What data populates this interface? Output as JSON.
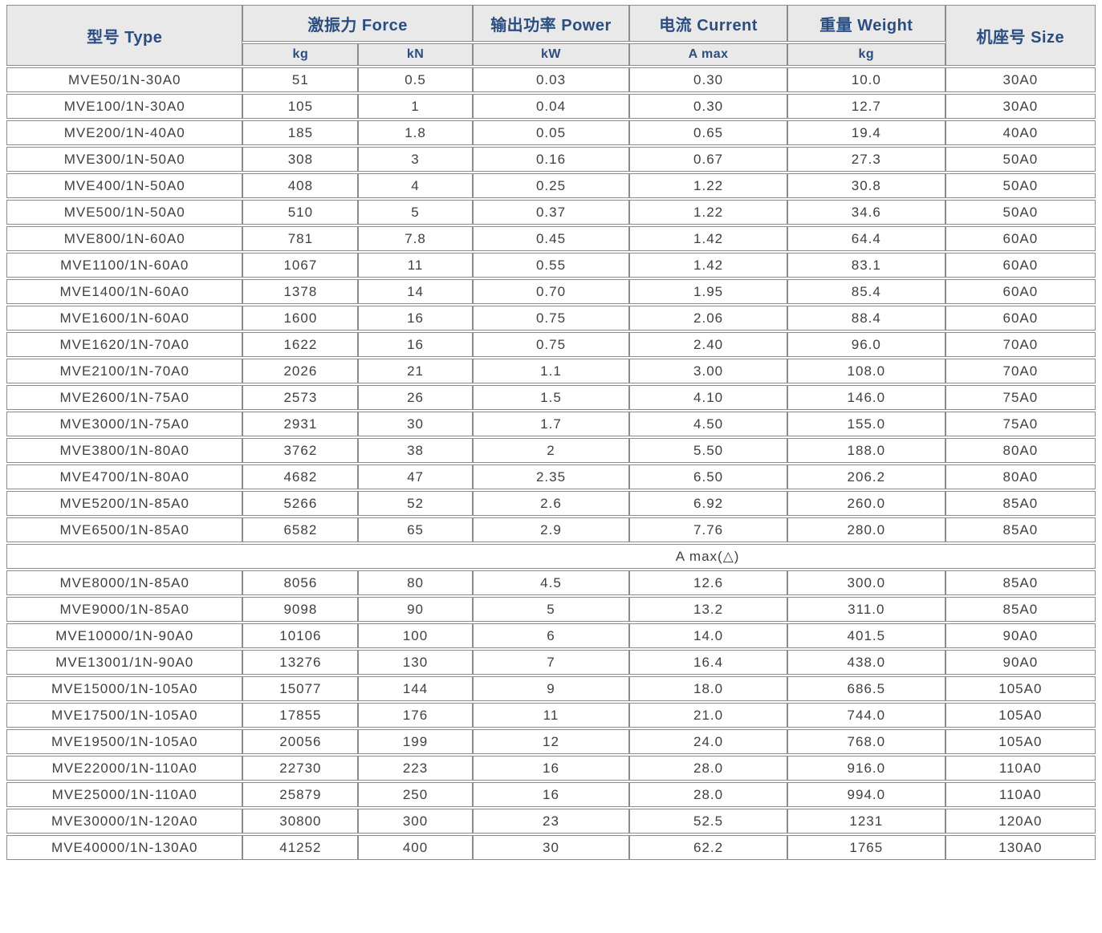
{
  "colors": {
    "header_bg": "#e9e9e9",
    "header_text": "#2b4d80",
    "body_text": "#3f3f3f",
    "border": "#8c8c8c"
  },
  "table": {
    "header": {
      "type": "型号 Type",
      "force": "激振力 Force",
      "power": "输出功率 Power",
      "current": "电流 Current",
      "weight": "重量 Weight",
      "size": "机座号 Size",
      "unit_force_kg": "kg",
      "unit_force_kn": "kN",
      "unit_power_kw": "kW",
      "unit_current_amax": "A max",
      "unit_weight_kg": "kg"
    },
    "separator_label": "A max(△)",
    "rows": [
      [
        "MVE50/1N-30A0",
        "51",
        "0.5",
        "0.03",
        "0.30",
        "10.0",
        "30A0"
      ],
      [
        "MVE100/1N-30A0",
        "105",
        "1",
        "0.04",
        "0.30",
        "12.7",
        "30A0"
      ],
      [
        "MVE200/1N-40A0",
        "185",
        "1.8",
        "0.05",
        "0.65",
        "19.4",
        "40A0"
      ],
      [
        "MVE300/1N-50A0",
        "308",
        "3",
        "0.16",
        "0.67",
        "27.3",
        "50A0"
      ],
      [
        "MVE400/1N-50A0",
        "408",
        "4",
        "0.25",
        "1.22",
        "30.8",
        "50A0"
      ],
      [
        "MVE500/1N-50A0",
        "510",
        "5",
        "0.37",
        "1.22",
        "34.6",
        "50A0"
      ],
      [
        "MVE800/1N-60A0",
        "781",
        "7.8",
        "0.45",
        "1.42",
        "64.4",
        "60A0"
      ],
      [
        "MVE1100/1N-60A0",
        "1067",
        "11",
        "0.55",
        "1.42",
        "83.1",
        "60A0"
      ],
      [
        "MVE1400/1N-60A0",
        "1378",
        "14",
        "0.70",
        "1.95",
        "85.4",
        "60A0"
      ],
      [
        "MVE1600/1N-60A0",
        "1600",
        "16",
        "0.75",
        "2.06",
        "88.4",
        "60A0"
      ],
      [
        "MVE1620/1N-70A0",
        "1622",
        "16",
        "0.75",
        "2.40",
        "96.0",
        "70A0"
      ],
      [
        "MVE2100/1N-70A0",
        "2026",
        "21",
        "1.1",
        "3.00",
        "108.0",
        "70A0"
      ],
      [
        "MVE2600/1N-75A0",
        "2573",
        "26",
        "1.5",
        "4.10",
        "146.0",
        "75A0"
      ],
      [
        "MVE3000/1N-75A0",
        "2931",
        "30",
        "1.7",
        "4.50",
        "155.0",
        "75A0"
      ],
      [
        "MVE3800/1N-80A0",
        "3762",
        "38",
        "2",
        "5.50",
        "188.0",
        "80A0"
      ],
      [
        "MVE4700/1N-80A0",
        "4682",
        "47",
        "2.35",
        "6.50",
        "206.2",
        "80A0"
      ],
      [
        "MVE5200/1N-85A0",
        "5266",
        "52",
        "2.6",
        "6.92",
        "260.0",
        "85A0"
      ],
      [
        "MVE6500/1N-85A0",
        "6582",
        "65",
        "2.9",
        "7.76",
        "280.0",
        "85A0"
      ]
    ],
    "rows_delta": [
      [
        "MVE8000/1N-85A0",
        "8056",
        "80",
        "4.5",
        "12.6",
        "300.0",
        "85A0"
      ],
      [
        "MVE9000/1N-85A0",
        "9098",
        "90",
        "5",
        "13.2",
        "311.0",
        "85A0"
      ],
      [
        "MVE10000/1N-90A0",
        "10106",
        "100",
        "6",
        "14.0",
        "401.5",
        "90A0"
      ],
      [
        "MVE13001/1N-90A0",
        "13276",
        "130",
        "7",
        "16.4",
        "438.0",
        "90A0"
      ],
      [
        "MVE15000/1N-105A0",
        "15077",
        "144",
        "9",
        "18.0",
        "686.5",
        "105A0"
      ],
      [
        "MVE17500/1N-105A0",
        "17855",
        "176",
        "11",
        "21.0",
        "744.0",
        "105A0"
      ],
      [
        "MVE19500/1N-105A0",
        "20056",
        "199",
        "12",
        "24.0",
        "768.0",
        "105A0"
      ],
      [
        "MVE22000/1N-110A0",
        "22730",
        "223",
        "16",
        "28.0",
        "916.0",
        "110A0"
      ],
      [
        "MVE25000/1N-110A0",
        "25879",
        "250",
        "16",
        "28.0",
        "994.0",
        "110A0"
      ],
      [
        "MVE30000/1N-120A0",
        "30800",
        "300",
        "23",
        "52.5",
        "1231",
        "120A0"
      ],
      [
        "MVE40000/1N-130A0",
        "41252",
        "400",
        "30",
        "62.2",
        "1765",
        "130A0"
      ]
    ]
  }
}
